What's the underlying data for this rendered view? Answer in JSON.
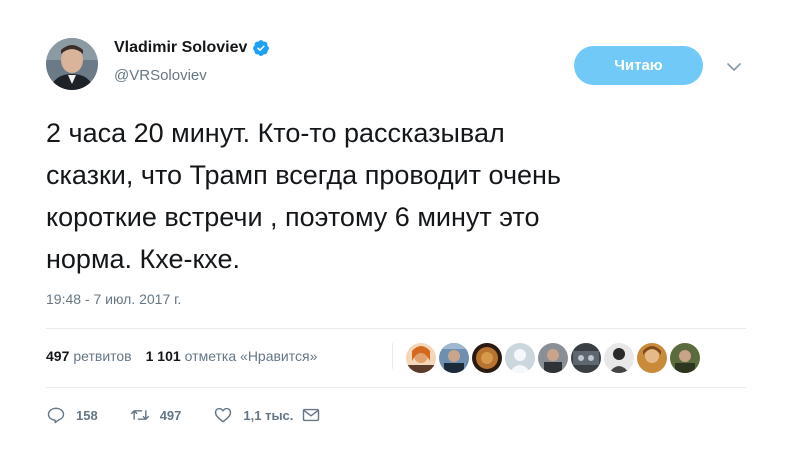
{
  "user": {
    "display_name": "Vladimir Soloviev",
    "handle": "@VRSoloviev",
    "verified": true
  },
  "follow_button": {
    "label": "Читаю"
  },
  "tweet": {
    "text": "2 часа 20 минут. Кто-то рассказывал\nсказки, что Трамп всегда проводит очень\nкороткие встречи , поэтому 6 минут это\nнорма. Кхе-кхе.",
    "timestamp": "19:48 - 7 июл. 2017 г."
  },
  "stats": {
    "retweets_count": "497",
    "retweets_label": "ретвитов",
    "likes_count": "1 101",
    "likes_label": "отметка «Нравится»"
  },
  "actions": {
    "reply_count": "158",
    "retweet_count": "497",
    "like_count": "1,1 тыс."
  },
  "colors": {
    "accent": "#1da1f2",
    "follow_button_bg": "#71c9f8",
    "muted_text": "#657786",
    "divider": "#e6ecf0"
  },
  "icons": {
    "verified": "verified-badge-icon",
    "chevron": "chevron-down-icon",
    "reply": "reply-icon",
    "retweet": "retweet-icon",
    "like": "heart-icon",
    "dm": "envelope-icon"
  }
}
